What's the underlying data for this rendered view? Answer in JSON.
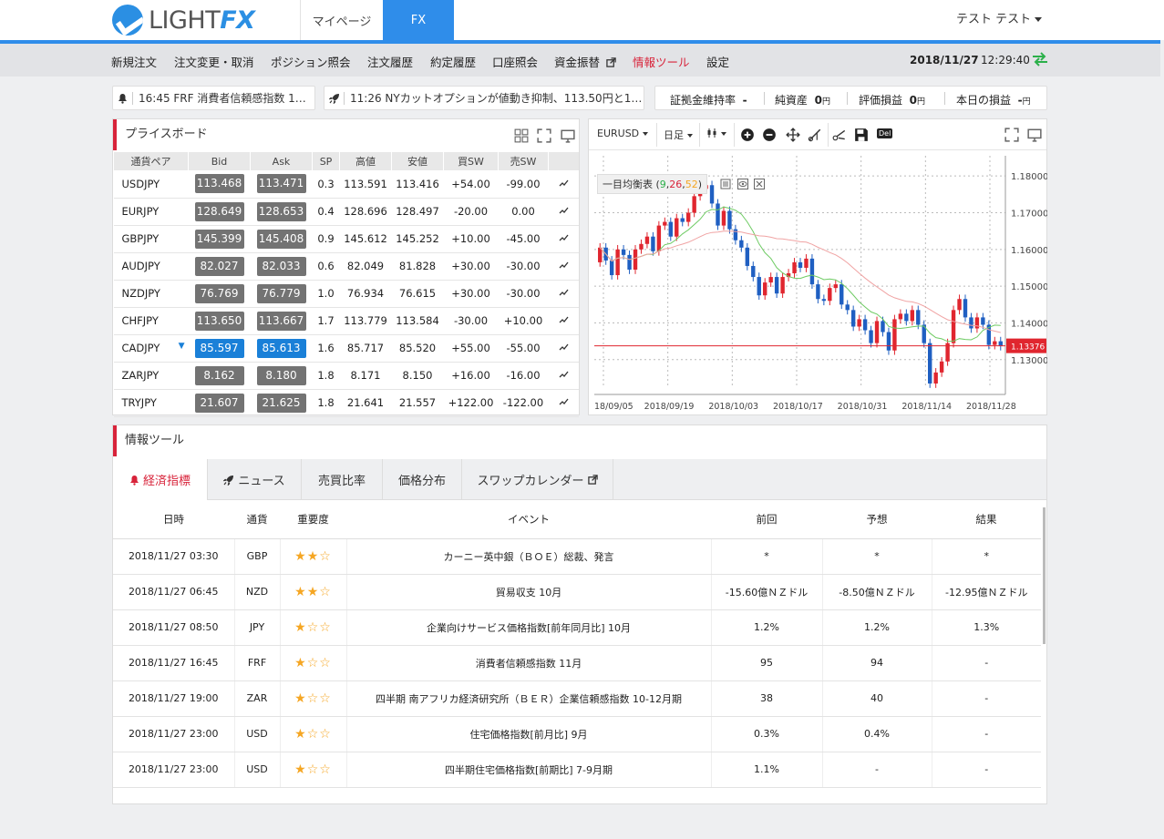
{
  "header": {
    "logo_text": "LIGHT",
    "logo_fx": "FX",
    "tabs": [
      {
        "label": "マイページ",
        "active": false
      },
      {
        "label": "FX",
        "active": true
      }
    ],
    "user_name": "テスト テスト"
  },
  "menu": {
    "items": [
      "新規注文",
      "注文変更・取消",
      "ポジション照会",
      "注文履歴",
      "約定履歴",
      "口座照会",
      "資金振替",
      "情報ツール",
      "設定"
    ],
    "highlight": "情報ツール",
    "date": "2018/11/27",
    "time": "12:29:40"
  },
  "tickers": [
    {
      "icon": "bell-icon",
      "text": "16:45 FRF 消費者信頼感指数 1…"
    },
    {
      "icon": "rocket-icon",
      "text": "11:26 NYカットオプションが値動き抑制、113.50円と1…"
    }
  ],
  "account_stats": {
    "margin_rate_label": "証拠金維持率",
    "margin_rate_value": "-",
    "net_assets_label": "純資産",
    "net_assets_value": "0",
    "unrealized_label": "評価損益",
    "unrealized_value": "0",
    "today_pl_label": "本日の損益",
    "today_pl_value": "-",
    "yen": "円"
  },
  "priceboard": {
    "title": "プライスボード",
    "columns": [
      "通貨ペア",
      "Bid",
      "Ask",
      "SP",
      "高値",
      "安値",
      "買SW",
      "売SW"
    ],
    "rows": [
      {
        "pair": "USDJPY",
        "bid": "113.468",
        "ask": "113.471",
        "sp": "0.3",
        "high": "113.591",
        "low": "113.416",
        "buy_sw": "+54.00",
        "sell_sw": "-99.00",
        "arrow": ""
      },
      {
        "pair": "EURJPY",
        "bid": "128.649",
        "ask": "128.653",
        "sp": "0.4",
        "high": "128.696",
        "low": "128.497",
        "buy_sw": "-20.00",
        "sell_sw": "0.00",
        "arrow": ""
      },
      {
        "pair": "GBPJPY",
        "bid": "145.399",
        "ask": "145.408",
        "sp": "0.9",
        "high": "145.612",
        "low": "145.252",
        "buy_sw": "+10.00",
        "sell_sw": "-45.00",
        "arrow": ""
      },
      {
        "pair": "AUDJPY",
        "bid": "82.027",
        "ask": "82.033",
        "sp": "0.6",
        "high": "82.049",
        "low": "81.828",
        "buy_sw": "+30.00",
        "sell_sw": "-30.00",
        "arrow": ""
      },
      {
        "pair": "NZDJPY",
        "bid": "76.769",
        "ask": "76.779",
        "sp": "1.0",
        "high": "76.934",
        "low": "76.615",
        "buy_sw": "+30.00",
        "sell_sw": "-30.00",
        "arrow": ""
      },
      {
        "pair": "CHFJPY",
        "bid": "113.650",
        "ask": "113.667",
        "sp": "1.7",
        "high": "113.779",
        "low": "113.584",
        "buy_sw": "-30.00",
        "sell_sw": "+10.00",
        "arrow": ""
      },
      {
        "pair": "CADJPY",
        "bid": "85.597",
        "ask": "85.613",
        "sp": "1.6",
        "high": "85.717",
        "low": "85.520",
        "buy_sw": "+55.00",
        "sell_sw": "-55.00",
        "arrow": "down"
      },
      {
        "pair": "ZARJPY",
        "bid": "8.162",
        "ask": "8.180",
        "sp": "1.8",
        "high": "8.171",
        "low": "8.150",
        "buy_sw": "+16.00",
        "sell_sw": "-16.00",
        "arrow": ""
      },
      {
        "pair": "TRYJPY",
        "bid": "21.607",
        "ask": "21.625",
        "sp": "1.8",
        "high": "21.641",
        "low": "21.557",
        "buy_sw": "+122.00",
        "sell_sw": "-122.00",
        "arrow": ""
      }
    ]
  },
  "chart_toolbar": {
    "symbol": "EURUSD",
    "period": "日足",
    "del_label": "Del",
    "indicator_label": "一目均衡表",
    "indicator_params": [
      "9",
      "26",
      "52"
    ]
  },
  "chart_data": {
    "type": "candlestick",
    "symbol": "EURUSD",
    "yticks": [
      "1.18000",
      "1.17000",
      "1.16000",
      "1.15000",
      "1.14000",
      "1.13000"
    ],
    "ylim": [
      1.123,
      1.1855
    ],
    "xticks": [
      "18/09/05",
      "2018/09/19",
      "2018/10/03",
      "2018/10/17",
      "2018/10/31",
      "2018/11/14",
      "2018/11/28"
    ],
    "current_price": "1.13376",
    "current_value": 1.13376,
    "candles": [
      [
        1.1565,
        1.1605
      ],
      [
        1.1605,
        1.157
      ],
      [
        1.157,
        1.153
      ],
      [
        1.153,
        1.16
      ],
      [
        1.16,
        1.1585
      ],
      [
        1.1585,
        1.1545
      ],
      [
        1.1545,
        1.16
      ],
      [
        1.16,
        1.1615
      ],
      [
        1.1615,
        1.1635
      ],
      [
        1.1635,
        1.1595
      ],
      [
        1.1595,
        1.1665
      ],
      [
        1.1665,
        1.1675
      ],
      [
        1.1675,
        1.1635
      ],
      [
        1.1635,
        1.1685
      ],
      [
        1.1685,
        1.1675
      ],
      [
        1.1675,
        1.17
      ],
      [
        1.17,
        1.1745
      ],
      [
        1.1745,
        1.1765
      ],
      [
        1.1765,
        1.1775
      ],
      [
        1.1775,
        1.1725
      ],
      [
        1.1725,
        1.1665
      ],
      [
        1.1665,
        1.1705
      ],
      [
        1.1705,
        1.1655
      ],
      [
        1.1655,
        1.1625
      ],
      [
        1.1625,
        1.1605
      ],
      [
        1.1605,
        1.1555
      ],
      [
        1.1555,
        1.1525
      ],
      [
        1.1525,
        1.1475
      ],
      [
        1.1475,
        1.151
      ],
      [
        1.151,
        1.1525
      ],
      [
        1.1525,
        1.148
      ],
      [
        1.148,
        1.1525
      ],
      [
        1.1525,
        1.1535
      ],
      [
        1.1535,
        1.1565
      ],
      [
        1.1565,
        1.155
      ],
      [
        1.155,
        1.1575
      ],
      [
        1.1575,
        1.1505
      ],
      [
        1.1505,
        1.1465
      ],
      [
        1.1465,
        1.146
      ],
      [
        1.146,
        1.1495
      ],
      [
        1.1495,
        1.1505
      ],
      [
        1.1505,
        1.145
      ],
      [
        1.145,
        1.1435
      ],
      [
        1.1435,
        1.139
      ],
      [
        1.139,
        1.141
      ],
      [
        1.141,
        1.138
      ],
      [
        1.138,
        1.1345
      ],
      [
        1.1345,
        1.1405
      ],
      [
        1.1405,
        1.1375
      ],
      [
        1.1375,
        1.1325
      ],
      [
        1.1325,
        1.141
      ],
      [
        1.141,
        1.1425
      ],
      [
        1.1425,
        1.1405
      ],
      [
        1.1405,
        1.1435
      ],
      [
        1.1435,
        1.1395
      ],
      [
        1.1395,
        1.1345
      ],
      [
        1.1345,
        1.1235
      ],
      [
        1.1235,
        1.1265
      ],
      [
        1.1265,
        1.1295
      ],
      [
        1.1295,
        1.1345
      ],
      [
        1.1345,
        1.1435
      ],
      [
        1.1435,
        1.1465
      ],
      [
        1.1465,
        1.1415
      ],
      [
        1.1415,
        1.1385
      ],
      [
        1.1385,
        1.1415
      ],
      [
        1.1415,
        1.1395
      ],
      [
        1.1395,
        1.134
      ],
      [
        1.134,
        1.135
      ],
      [
        1.135,
        1.1337
      ]
    ]
  },
  "info_tools": {
    "title": "情報ツール",
    "tabs": [
      {
        "label": "経済指標",
        "icon": "bell-icon",
        "active": true
      },
      {
        "label": "ニュース",
        "icon": "rocket-icon",
        "active": false
      },
      {
        "label": "売買比率",
        "icon": "",
        "active": false
      },
      {
        "label": "価格分布",
        "icon": "",
        "active": false
      },
      {
        "label": "スワップカレンダー",
        "icon": "external-link-icon",
        "active": false
      }
    ],
    "columns": [
      "日時",
      "通貨",
      "重要度",
      "イベント",
      "前回",
      "予想",
      "結果"
    ],
    "events": [
      {
        "datetime": "2018/11/27 03:30",
        "currency": "GBP",
        "stars": "★★☆",
        "event": "カーニー英中銀（ＢＯＥ）総裁、発言",
        "previous": "*",
        "forecast": "*",
        "result": "*"
      },
      {
        "datetime": "2018/11/27 06:45",
        "currency": "NZD",
        "stars": "★★☆",
        "event": "貿易収支 10月",
        "previous": "-15.60億ＮＺドル",
        "forecast": "-8.50億ＮＺドル",
        "result": "-12.95億ＮＺドル"
      },
      {
        "datetime": "2018/11/27 08:50",
        "currency": "JPY",
        "stars": "★☆☆",
        "event": "企業向けサービス価格指数[前年同月比] 10月",
        "previous": "1.2%",
        "forecast": "1.2%",
        "result": "1.3%"
      },
      {
        "datetime": "2018/11/27 16:45",
        "currency": "FRF",
        "stars": "★☆☆",
        "event": "消費者信頼感指数 11月",
        "previous": "95",
        "forecast": "94",
        "result": "-"
      },
      {
        "datetime": "2018/11/27 19:00",
        "currency": "ZAR",
        "stars": "★☆☆",
        "event": "四半期 南アフリカ経済研究所（ＢＥＲ）企業信頼感指数 10-12月期",
        "previous": "38",
        "forecast": "40",
        "result": "-"
      },
      {
        "datetime": "2018/11/27 23:00",
        "currency": "USD",
        "stars": "★☆☆",
        "event": "住宅価格指数[前月比] 9月",
        "previous": "0.3%",
        "forecast": "0.4%",
        "result": "-"
      },
      {
        "datetime": "2018/11/27 23:00",
        "currency": "USD",
        "stars": "★☆☆",
        "event": "四半期住宅価格指数[前期比] 7-9月期",
        "previous": "1.1%",
        "forecast": "-",
        "result": "-"
      }
    ]
  }
}
